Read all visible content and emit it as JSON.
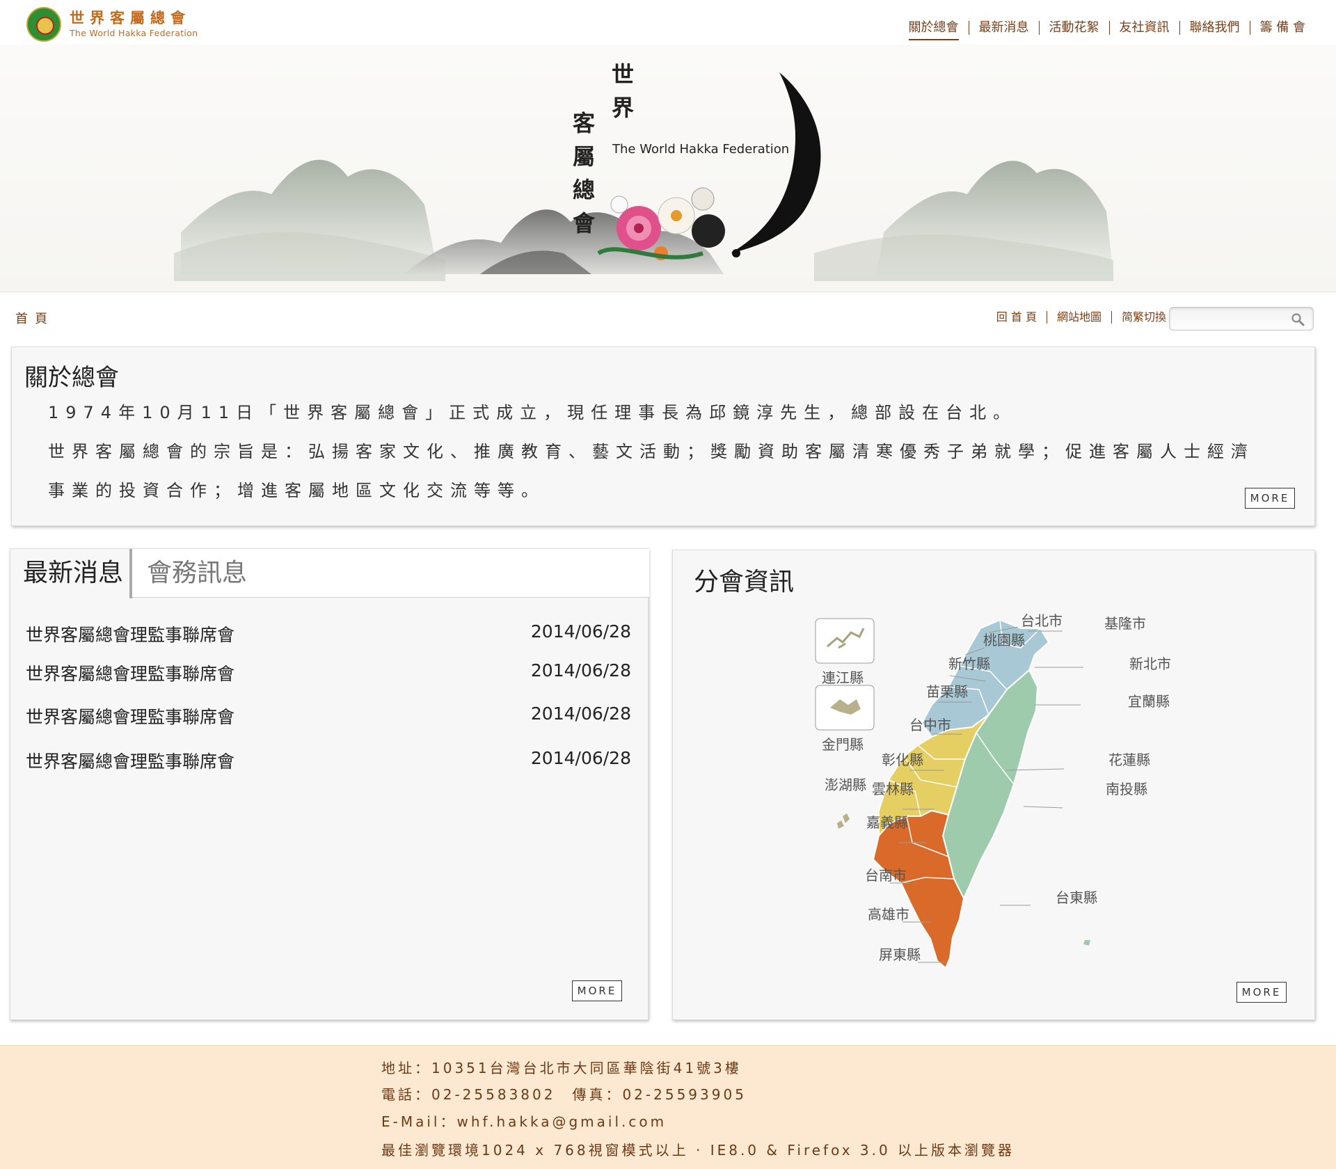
{
  "logo": {
    "cn": "世界客屬總會",
    "en": "The World Hakka Federation"
  },
  "topnav": [
    "關於總會",
    "最新消息",
    "活動花絮",
    "友社資訊",
    "聯絡我們",
    "籌 備 會"
  ],
  "banner": {
    "title_top": "世界",
    "title_bottom": "客屬總會",
    "subtitle_en": "The World Hakka Federation"
  },
  "breadcrumb": "首頁",
  "utilnav": [
    "回 首 頁",
    "網站地圖",
    "简繁切換"
  ],
  "search": {
    "placeholder": ""
  },
  "about": {
    "title": "關於總會",
    "para1": "1974年10月11日「世界客屬總會」正式成立，現任理事長為邱鏡淳先生，總部設在台北。",
    "para2": "世界客屬總會的宗旨是：弘揚客家文化、推廣教育、藝文活動；獎勵資助客屬清寒優秀子弟就學；促進客屬人士經濟事業的投資合作；增進客屬地區文化交流等等。",
    "more": "MORE"
  },
  "news": {
    "tab_active": "最新消息",
    "tab_inactive": "會務訊息",
    "items": [
      {
        "title": "世界客屬總會理監事聯席會",
        "date": "2014/06/28"
      },
      {
        "title": "世界客屬總會理監事聯席會",
        "date": "2014/06/28"
      },
      {
        "title": "世界客屬總會理監事聯席會",
        "date": "2014/06/28"
      },
      {
        "title": "世界客屬總會理監事聯席會",
        "date": "2014/06/28"
      }
    ],
    "more": "MORE"
  },
  "branch": {
    "title": "分會資訊",
    "counties": [
      "台北市",
      "基隆市",
      "桃園縣",
      "新北市",
      "新竹縣",
      "苗栗縣",
      "宜蘭縣",
      "台中市",
      "彰化縣",
      "花蓮縣",
      "澎湖縣",
      "雲林縣",
      "南投縣",
      "嘉義縣",
      "台南市",
      "台東縣",
      "高雄市",
      "屏東縣"
    ],
    "islands": [
      "連江縣",
      "金門縣"
    ],
    "colors": {
      "north": "#a8c8d6",
      "central": "#e5cf63",
      "south": "#d96a2a",
      "east": "#9fcbad"
    },
    "more": "MORE"
  },
  "footer": {
    "address": "地址：10351台灣台北市大同區華陰街41號3樓",
    "phone": "電話：02-25583802　傳真：02-25593905",
    "email": "E-Mail：whf.hakka@gmail.com",
    "browser": "最佳瀏覽環境1024 x 768視窗模式以上 · IE8.0 & Firefox 3.0 以上版本瀏覽器"
  }
}
